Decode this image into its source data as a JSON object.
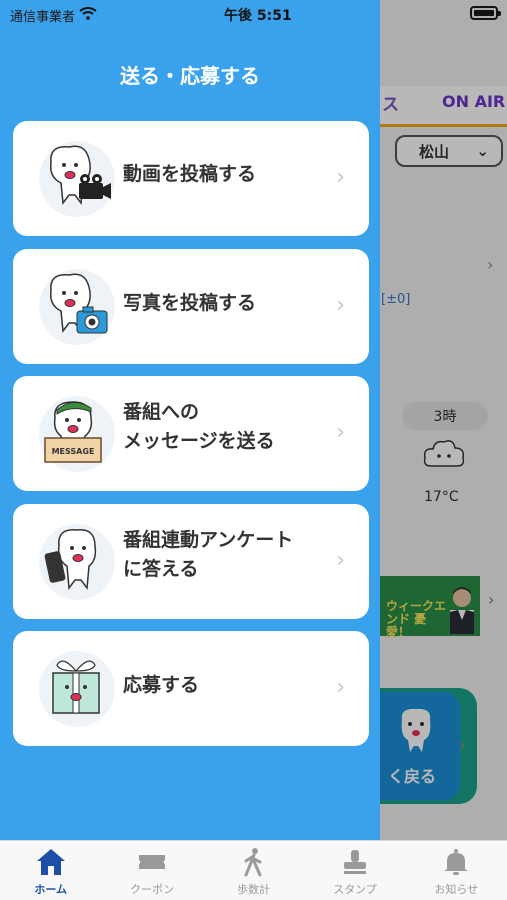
{
  "status_bar": {
    "carrier": "通信事業者",
    "time": "午後 5:51"
  },
  "background": {
    "tab_partial": "ス",
    "tab_onair": "ON AIR",
    "region_select": "松山",
    "diff_text": "[±0]",
    "forecast_time": "3時",
    "forecast_temp": "17°C",
    "banner_text": "ウィークエンド 憂愛！",
    "back_button": "く戻る"
  },
  "drawer": {
    "title": "送る・応募する",
    "items": [
      {
        "label": "動画を投稿する",
        "icon": "video-camera-mascot-icon"
      },
      {
        "label": "写真を投稿する",
        "icon": "photo-camera-mascot-icon"
      },
      {
        "label": "番組への\nメッセージを送る",
        "icon": "message-board-mascot-icon",
        "badge": "MESSAGE"
      },
      {
        "label": "番組連動アンケート\nに答える",
        "icon": "smartphone-mascot-icon"
      },
      {
        "label": "応募する",
        "icon": "gift-box-mascot-icon"
      }
    ]
  },
  "tabbar": {
    "items": [
      {
        "label": "ホーム",
        "icon": "home-icon",
        "active": true
      },
      {
        "label": "クーポン",
        "icon": "coupon-icon",
        "active": false
      },
      {
        "label": "歩数計",
        "icon": "walking-icon",
        "active": false
      },
      {
        "label": "スタンプ",
        "icon": "stamp-icon",
        "active": false
      },
      {
        "label": "お知らせ",
        "icon": "bell-icon",
        "active": false
      }
    ]
  },
  "colors": {
    "drawer_bg": "#3aa2ec",
    "active_tab": "#1d4fa8",
    "onair": "#6b35c9",
    "back_button": "#1c8fd6"
  }
}
